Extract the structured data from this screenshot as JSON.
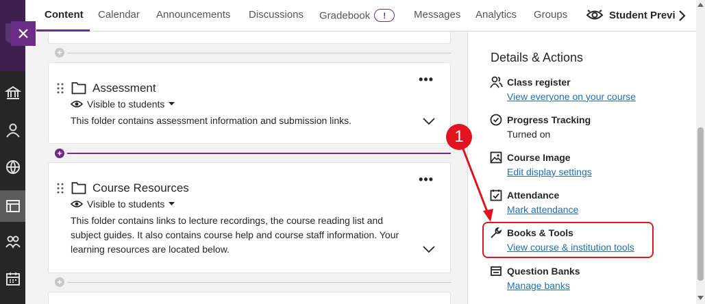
{
  "tabs": [
    {
      "label": "Content",
      "active": true
    },
    {
      "label": "Calendar"
    },
    {
      "label": "Announcements"
    },
    {
      "label": "Discussions"
    },
    {
      "label": "Gradebook",
      "badge": "!"
    },
    {
      "label": "Messages"
    },
    {
      "label": "Analytics"
    },
    {
      "label": "Groups"
    }
  ],
  "student_preview_label": "Student Previ",
  "cards": [
    {
      "title": "Assessment",
      "visibility": "Visible to students",
      "description": "This folder contains assessment information and submission links."
    },
    {
      "title": "Course Resources",
      "visibility": "Visible to students",
      "description": "This folder contains links to lecture recordings, the course reading list and subject guides. It also contains course help and course staff information. Your learning resources are located below."
    }
  ],
  "details": {
    "heading": "Details & Actions",
    "items": [
      {
        "icon": "people-icon",
        "title": "Class register",
        "sub": "View everyone on your course"
      },
      {
        "icon": "check-circle-icon",
        "title": "Progress Tracking",
        "sub": "Turned on"
      },
      {
        "icon": "image-icon",
        "title": "Course Image",
        "sub": "Edit display settings"
      },
      {
        "icon": "attendance-icon",
        "title": "Attendance",
        "sub": "Mark attendance"
      },
      {
        "icon": "wrench-icon",
        "title": "Books & Tools",
        "sub": "View course & institution tools"
      },
      {
        "icon": "bank-icon",
        "title": "Question Banks",
        "sub": "Manage banks"
      }
    ]
  },
  "callout_number": "1",
  "accent_color": "#6c2d87",
  "annotation_color": "#e0131f",
  "link_color": "#1f6fb2"
}
